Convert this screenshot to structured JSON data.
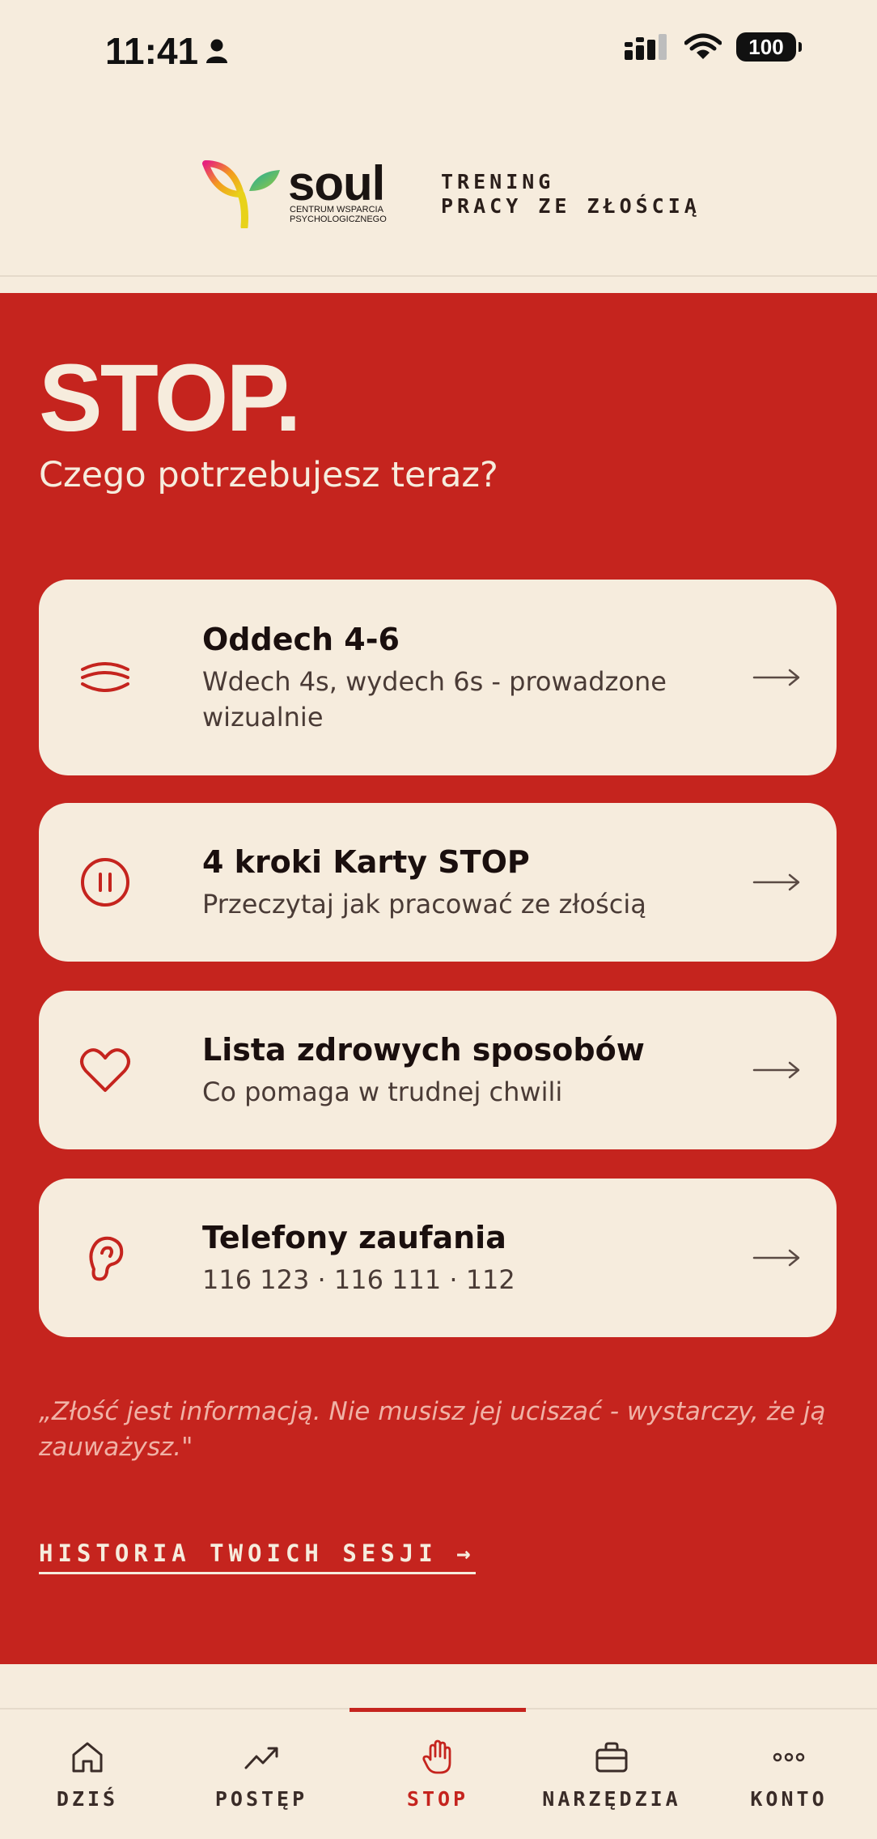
{
  "status_bar": {
    "time": "11:41",
    "battery": "100"
  },
  "header": {
    "logo_word": "soul",
    "logo_sub_line1": "CENTRUM WSPARCIA",
    "logo_sub_line2": "PSYCHOLOGICZNEGO",
    "tagline_line1": "TRENING",
    "tagline_line2": "PRACY ZE ZŁOŚCIĄ"
  },
  "main": {
    "title": "STOP.",
    "subtitle": "Czego potrzebujesz teraz?",
    "cards": [
      {
        "title": "Oddech 4-6",
        "desc": "Wdech 4s, wydech 6s - prowadzone wizualnie",
        "icon": "wind-icon"
      },
      {
        "title": "4 kroki Karty STOP",
        "desc": "Przeczytaj jak pracować ze złością",
        "icon": "pause-icon"
      },
      {
        "title": "Lista zdrowych sposobów",
        "desc": "Co pomaga w trudnej chwili",
        "icon": "heart-icon"
      },
      {
        "title": "Telefony zaufania",
        "desc": "116 123 · 116 111 · 112",
        "icon": "ear-icon"
      }
    ],
    "quote": "„Złość jest informacją. Nie musisz jej uciszać - wystarczy, że ją zauważysz.\"",
    "history_link": "HISTORIA TWOICH SESJI →"
  },
  "tabbar": {
    "tabs": [
      {
        "label": "DZIŚ",
        "icon": "home-icon"
      },
      {
        "label": "POSTĘP",
        "icon": "trend-up-icon"
      },
      {
        "label": "STOP",
        "icon": "hand-icon",
        "active": true
      },
      {
        "label": "NARZĘDZIA",
        "icon": "toolbox-icon"
      },
      {
        "label": "KONTO",
        "icon": "more-dots-icon"
      }
    ]
  },
  "colors": {
    "accent": "#C5241E",
    "background": "#F6ECDD",
    "text": "#1A0F0E"
  }
}
